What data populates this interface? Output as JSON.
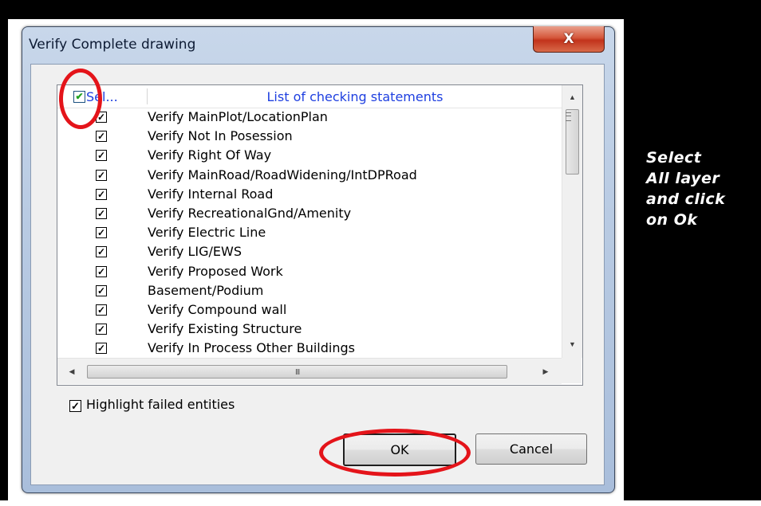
{
  "dialog": {
    "title": "Verify Complete drawing",
    "close_glyph": "X"
  },
  "list": {
    "header_select_label": "Sel...",
    "header_statements_label": "List of checking statements",
    "header_select_all_checked": true,
    "rows": [
      {
        "checked": true,
        "label": "Verify MainPlot/LocationPlan"
      },
      {
        "checked": true,
        "label": "Verify Not In Posession"
      },
      {
        "checked": true,
        "label": "Verify Right Of Way"
      },
      {
        "checked": true,
        "label": "Verify MainRoad/RoadWidening/IntDPRoad"
      },
      {
        "checked": true,
        "label": "Verify Internal Road"
      },
      {
        "checked": true,
        "label": "Verify RecreationalGnd/Amenity"
      },
      {
        "checked": true,
        "label": "Verify Electric Line"
      },
      {
        "checked": true,
        "label": "Verify LIG/EWS"
      },
      {
        "checked": true,
        "label": "Verify Proposed Work"
      },
      {
        "checked": true,
        "label": "Basement/Podium"
      },
      {
        "checked": true,
        "label": "Verify Compound wall"
      },
      {
        "checked": true,
        "label": "Verify Existing Structure"
      },
      {
        "checked": true,
        "label": "Verify In Process Other Buildings"
      }
    ],
    "hscroll_grip": "III"
  },
  "options": {
    "highlight_label": "Highlight failed entities",
    "highlight_checked": true
  },
  "buttons": {
    "ok_label": "OK",
    "cancel_label": "Cancel"
  },
  "annotation": {
    "side_note": "Select\nAll layer\nand click\non Ok",
    "circle_color": "#e4141a"
  }
}
